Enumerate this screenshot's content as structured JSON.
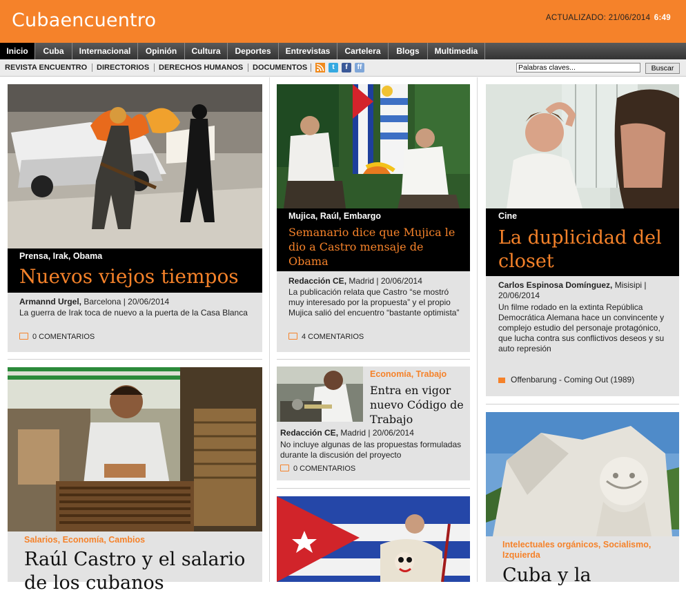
{
  "header": {
    "logo": "Cubaencuentro",
    "updated_label": "ACTUALIZADO: 21/06/2014",
    "updated_time": "6:49"
  },
  "nav": [
    {
      "label": "Inicio",
      "active": true
    },
    {
      "label": "Cuba"
    },
    {
      "label": "Internacional"
    },
    {
      "label": "Opinión"
    },
    {
      "label": "Cultura"
    },
    {
      "label": "Deportes"
    },
    {
      "label": "Entrevistas"
    },
    {
      "label": "Cartelera"
    },
    {
      "label": "Blogs"
    },
    {
      "label": "Multimedia"
    }
  ],
  "subnav": [
    {
      "label": "REVISTA ENCUENTRO"
    },
    {
      "label": "DIRECTORIOS"
    },
    {
      "label": "DERECHOS HUMANOS"
    },
    {
      "label": "DOCUMENTOS"
    }
  ],
  "social_icons": [
    "rss-icon",
    "twitter-icon",
    "facebook-icon",
    "friendfeed-icon"
  ],
  "search": {
    "value": "Palabras claves...",
    "button": "Buscar"
  },
  "colors": {
    "brand": "#f5822a",
    "nav": "#333333",
    "card": "#e3e3e3"
  },
  "articles": {
    "a1": {
      "tags": "Prensa, Irak, Obama",
      "title": "Nuevos viejos tiempos",
      "author": "Armannd Urgel,",
      "place_date": " Barcelona | 20/06/2014",
      "summary": "La guerra de Irak toca de nuevo a la puerta de la Casa Blanca",
      "comments": "0 COMENTARIOS"
    },
    "a2": {
      "tags": "Mujica, Raúl, Embargo",
      "title": "Semanario dice que Mujica le dio a Castro mensaje de Obama",
      "author": "Redacción CE,",
      "place_date": " Madrid | 20/06/2014",
      "summary": "La publicación relata que Castro “se mostró muy interesado por la propuesta” y el propio Mujica salió del encuentro “bastante optimista”",
      "comments": "4 COMENTARIOS"
    },
    "a3": {
      "tags": "Cine",
      "title": "La duplicidad del closet",
      "author": "Carlos Espinosa Domínguez,",
      "place_date": " Misisipi | 20/06/2014",
      "summary": "Un filme rodado en la extinta República Democrática Alemana hace un convincente y complejo estudio del personaje protagónico, que lucha contra sus conflictivos deseos y su auto represión",
      "video": "Offenbarung - Coming Out (1989)"
    },
    "a4": {
      "tags": "Salarios, Economía, Cambios",
      "title": "Raúl Castro y el salario de los cubanos"
    },
    "a5": {
      "tags": "Economía, Trabajo",
      "title": "Entra en vigor nuevo Código de Trabajo",
      "author": "Redacción CE,",
      "place_date": " Madrid | 20/06/2014",
      "summary": "No incluye algunas de las propuestas formuladas durante la discusión del proyecto",
      "comments": "0 COMENTARIOS"
    },
    "a6": {
      "tags": "Intelectuales orgánicos, Socialismo, Izquierda",
      "title": "Cuba y la"
    }
  }
}
